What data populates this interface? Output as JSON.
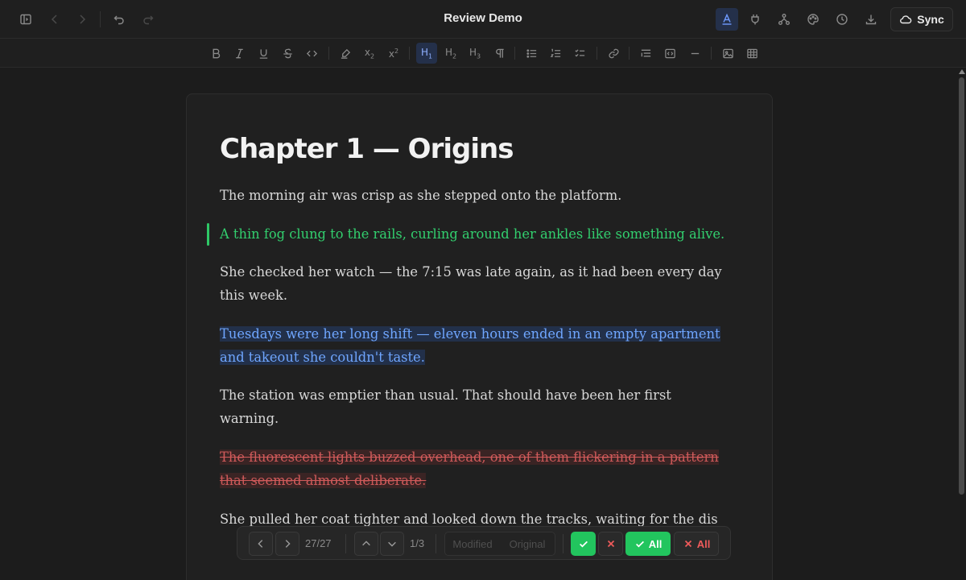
{
  "window": {
    "title": "Review Demo",
    "sync_label": "Sync"
  },
  "document": {
    "title": "Chapter 1 — Origins",
    "paragraphs": [
      {
        "status": "unchanged",
        "text": "The morning air was crisp as she stepped onto the platform."
      },
      {
        "status": "added",
        "text": "A thin fog clung to the rails, curling around her ankles like something alive."
      },
      {
        "status": "unchanged",
        "text": "She checked her watch — the 7:15 was late again, as it had been every day this week."
      },
      {
        "status": "modified",
        "text": "Tuesdays were her long shift — eleven hours ended in an empty apartment and takeout she couldn't taste."
      },
      {
        "status": "unchanged",
        "text": "The station was emptier than usual. That should have been her first warning."
      },
      {
        "status": "deleted",
        "text": "The fluorescent lights buzzed overhead, one of them flickering in a pattern that seemed almost deliberate."
      },
      {
        "status": "unchanged",
        "text": "She pulled her coat tighter and looked down the tracks, waiting for the dis"
      }
    ]
  },
  "review": {
    "change_counter": "27/27",
    "block_counter": "1/3",
    "view_modified": "Modified",
    "view_original": "Original",
    "accept_all_label": "All",
    "reject_all_label": "All"
  },
  "colors": {
    "accent": "#22c55e",
    "added": "#32cf6e",
    "modified": "#6fa6ff",
    "deleted": "#d05a5a"
  }
}
